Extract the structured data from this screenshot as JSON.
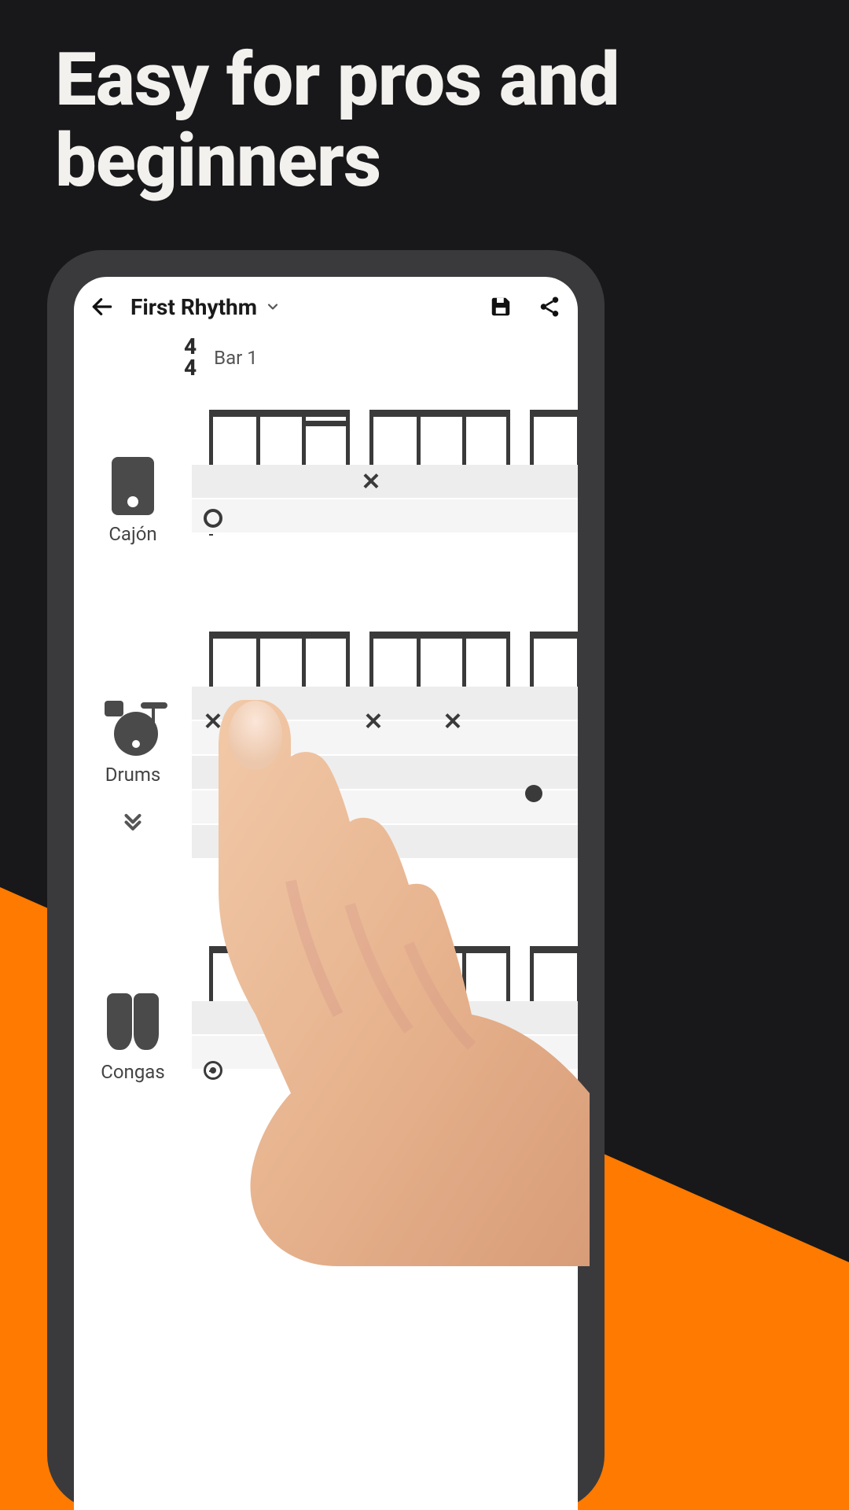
{
  "promo": {
    "headline": "Easy for pros and beginners"
  },
  "header": {
    "title": "First Rhythm"
  },
  "meta": {
    "timesig_top": "4",
    "timesig_bottom": "4",
    "bar_label": "Bar 1"
  },
  "tracks": {
    "cajon": {
      "label": "Cajón"
    },
    "drums": {
      "label": "Drums"
    },
    "congas": {
      "label": "Congas"
    }
  }
}
